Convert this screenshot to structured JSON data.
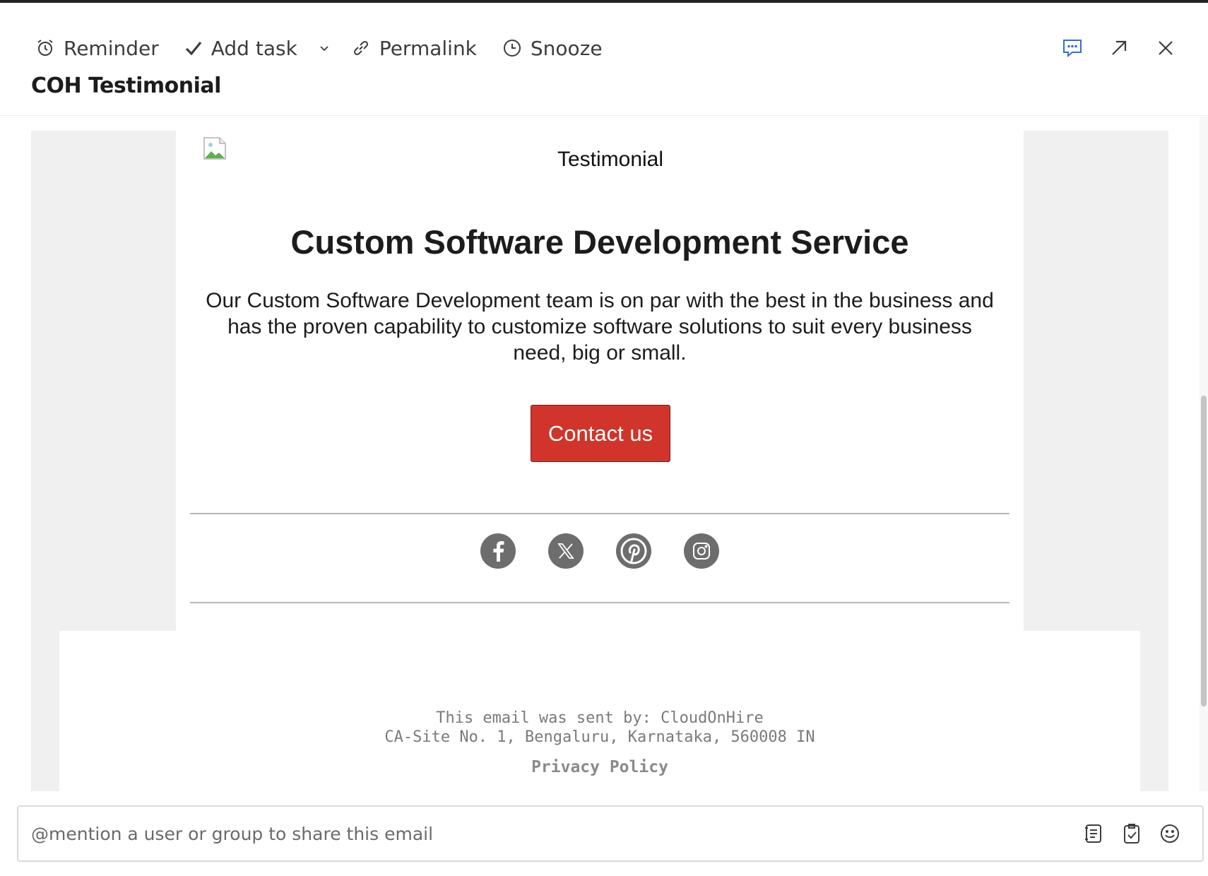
{
  "toolbar": {
    "reminder_label": "Reminder",
    "add_task_label": "Add task",
    "permalink_label": "Permalink",
    "snooze_label": "Snooze",
    "icons": [
      "alarm-clock-icon",
      "checkmark-icon",
      "chevron-down-icon",
      "link-icon",
      "clock-icon"
    ]
  },
  "window_controls": {
    "icons": [
      "comment-icon",
      "expand-arrow-icon",
      "close-icon"
    ],
    "accent_color": "#2f6fd6"
  },
  "subject": "COH Testimonial",
  "email": {
    "header_image_alt": "Testimonial",
    "headline": "Custom Software Development Service",
    "body": "Our Custom Software Development team is on par with the best in the business and has the proven capability to customize software solutions to suit every business need, big or small.",
    "cta_label": "Contact us",
    "cta_color": "#d1342a",
    "social_icons": [
      "facebook-icon",
      "x-twitter-icon",
      "pinterest-icon",
      "instagram-icon"
    ],
    "footer": {
      "sent_by": "This email was sent by: CloudOnHire",
      "address": "CA-Site No. 1, Bengaluru, Karnataka, 560008 IN",
      "privacy_link": "Privacy Policy"
    }
  },
  "composer": {
    "placeholder": "@mention a user or group to share this email",
    "icons": [
      "notes-icon",
      "clipboard-check-icon",
      "smiley-icon"
    ]
  }
}
